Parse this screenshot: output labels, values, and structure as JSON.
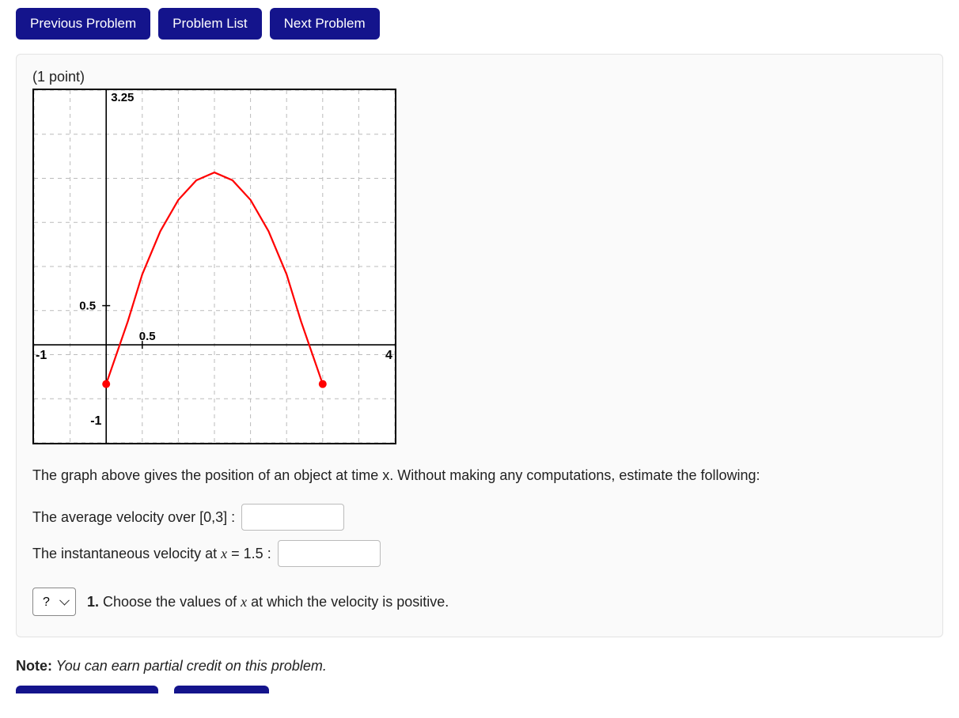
{
  "nav": {
    "prev": "Previous Problem",
    "list": "Problem List",
    "next": "Next Problem"
  },
  "problem": {
    "points": "(1 point)",
    "prompt": "The graph above gives the position of an object at time x. Without making any computations, estimate the following:",
    "q1_label": "The average velocity over [0,3] :",
    "q2_prefix": "The instantaneous velocity at ",
    "q2_var": "x",
    "q2_eq": " = ",
    "q2_val": "1.5",
    "q2_colon": " :",
    "dropdown_selected": "?",
    "dropdown_prompt_num": "1.",
    "dropdown_prompt_a": " Choose the values of ",
    "dropdown_prompt_var": "x",
    "dropdown_prompt_b": " at which the velocity is positive."
  },
  "note": {
    "label": "Note:",
    "text": " You can earn partial credit on this problem."
  },
  "chart_data": {
    "type": "line",
    "title": "",
    "xlabel": "",
    "ylabel": "",
    "xlim": [
      -1,
      4
    ],
    "ylim": [
      -1.25,
      3.25
    ],
    "x_ticks": [
      "-1",
      "0.5",
      "4"
    ],
    "y_ticks": [
      "-1",
      "0.5",
      "3.25"
    ],
    "grid": true,
    "series": [
      {
        "name": "position",
        "color": "#ff0000",
        "x": [
          0,
          0.15,
          0.3,
          0.5,
          0.75,
          1.0,
          1.25,
          1.5,
          1.75,
          2.0,
          2.25,
          2.5,
          2.7,
          2.85,
          3.0
        ],
        "y": [
          -0.5,
          -0.1,
          0.3,
          0.9,
          1.45,
          1.85,
          2.1,
          2.2,
          2.1,
          1.85,
          1.45,
          0.9,
          0.3,
          -0.1,
          -0.5
        ],
        "endpoints": [
          {
            "x": 0,
            "y": -0.5
          },
          {
            "x": 3.0,
            "y": -0.5
          }
        ]
      }
    ]
  }
}
